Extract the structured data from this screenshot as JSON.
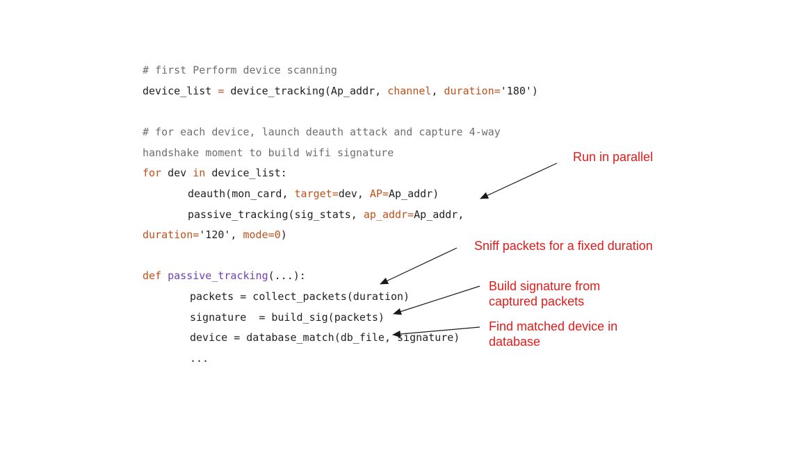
{
  "code": {
    "l1_comment": "# first Perform device scanning",
    "l2": {
      "a": "device_list ",
      "eq": "=",
      "b": " device_tracking(Ap_addr, ",
      "p1": "channel",
      "c": ", ",
      "p2": "duration=",
      "d": "'180')"
    },
    "l3_comment": "# for each device, launch deauth attack and capture 4-way",
    "l4_comment": "handshake moment to build wifi signature",
    "l5": {
      "kw1": "for",
      "a": " dev ",
      "kw2": "in",
      "b": " device_list:"
    },
    "l6": {
      "a": "deauth(mon_card, ",
      "p1": "target=",
      "b": "dev, ",
      "p2": "AP=",
      "c": "Ap_addr)"
    },
    "l7": {
      "a": "passive_tracking(sig_stats, ",
      "p1": "ap_addr=",
      "b": "Ap_addr,"
    },
    "l8": {
      "p1": "duration=",
      "a": "'120', ",
      "p2": "mode=",
      "n": "0",
      "b": ")"
    },
    "l9": {
      "kw": "def",
      "sp": " ",
      "fn": "passive_tracking",
      "b": "(...):"
    },
    "l10": "packets = collect_packets(duration)",
    "l11": "signature  = build_sig(packets)",
    "l12": "device = database_match(db_file, signature)",
    "l13": "..."
  },
  "annotations": {
    "run_parallel": "Run in parallel",
    "sniff": "Sniff packets for a fixed duration",
    "build_sig": "Build signature from\ncaptured packets",
    "find_match": "Find matched device in\ndatabase"
  },
  "colors": {
    "annotation": "#e21b1b",
    "keyword": "#c0501a",
    "function": "#6f3fb5",
    "comment": "#6f6f6f"
  }
}
